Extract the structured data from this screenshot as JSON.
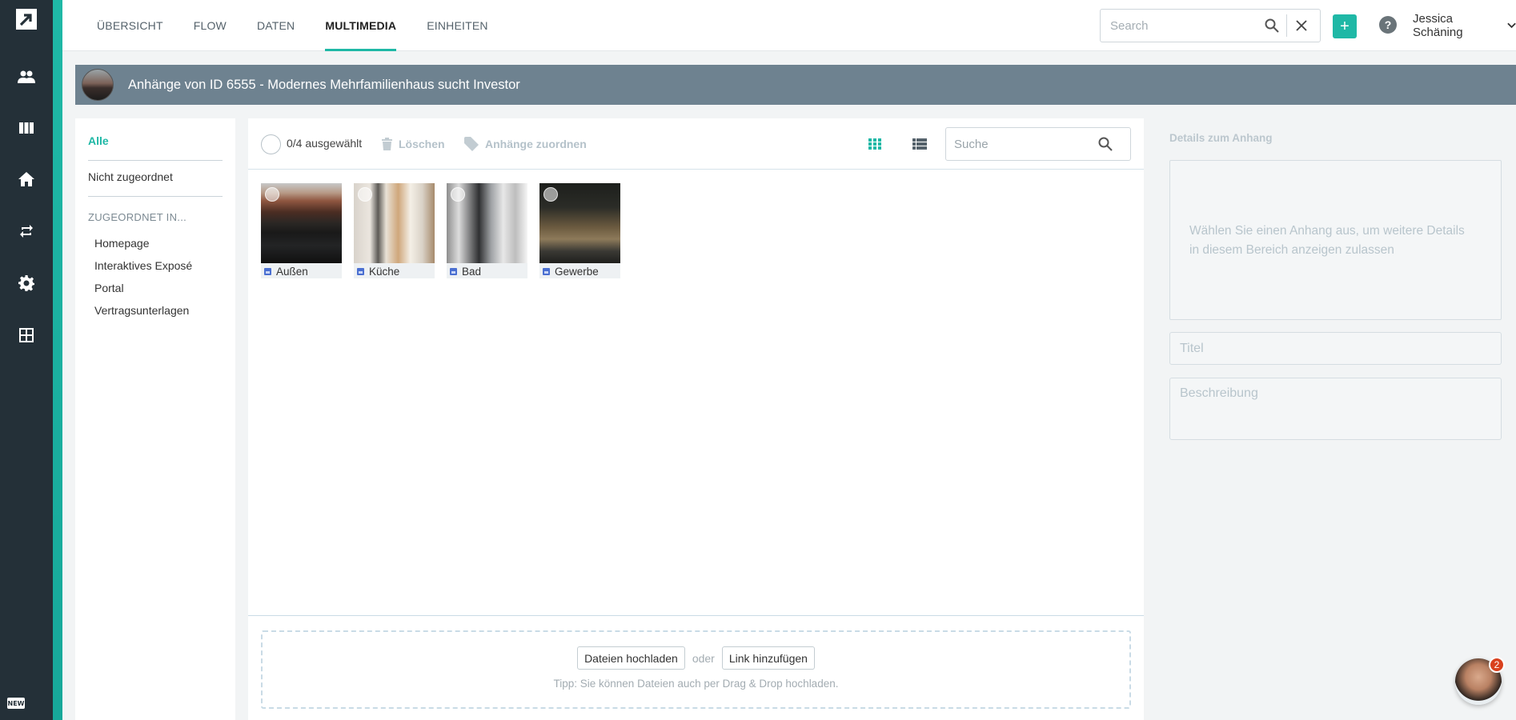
{
  "nav": {
    "logo": "arrow-logo-icon",
    "items": [
      "people-icon",
      "columns-icon",
      "home-icon",
      "repeat-icon",
      "gear-icon",
      "grid-icon"
    ],
    "new_badge": "NEW"
  },
  "topbar": {
    "tabs": [
      {
        "label": "ÜBERSICHT",
        "active": false
      },
      {
        "label": "FLOW",
        "active": false
      },
      {
        "label": "DATEN",
        "active": false
      },
      {
        "label": "MULTIMEDIA",
        "active": true
      },
      {
        "label": "EINHEITEN",
        "active": false
      }
    ],
    "search_placeholder": "Search",
    "user_name": "Jessica Schäning"
  },
  "banner": {
    "title": "Anhänge von ID 6555 - Modernes Mehrfamilienhaus sucht Investor"
  },
  "filter": {
    "all": "Alle",
    "unassigned": "Nicht zugeordnet",
    "section": "ZUGEORDNET IN...",
    "assigned": [
      "Homepage",
      "Interaktives Exposé",
      "Portal",
      "Vertragsunterlagen"
    ]
  },
  "toolbar": {
    "selection": "0/4 ausgewählt",
    "delete_label": "Löschen",
    "assign_label": "Anhänge zuordnen",
    "search_placeholder": "Suche"
  },
  "attachments": [
    {
      "caption": "Außen"
    },
    {
      "caption": "Küche"
    },
    {
      "caption": "Bad"
    },
    {
      "caption": "Gewerbe"
    }
  ],
  "upload": {
    "upload_button": "Dateien hochladen",
    "or": "oder",
    "link_button": "Link hinzufügen",
    "tip": "Tipp: Sie können Dateien auch per Drag & Drop hochladen."
  },
  "details": {
    "heading": "Details zum Anhang",
    "message": "Wählen Sie einen Anhang aus, um weitere Details in diesem Bereich anzeigen zulassen",
    "title_placeholder": "Titel",
    "description_placeholder": "Beschreibung"
  },
  "chat": {
    "badge_count": "2"
  },
  "colors": {
    "accent": "#1fb8a6",
    "nav": "#243038",
    "banner": "#6e8290"
  }
}
